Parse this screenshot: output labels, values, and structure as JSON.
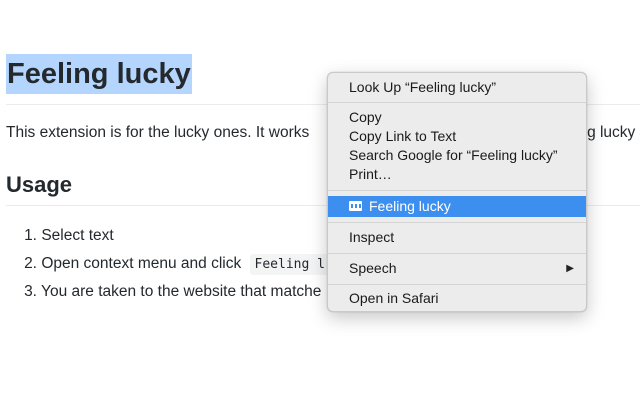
{
  "document": {
    "title": "Feeling lucky",
    "intro": "This extension is for the lucky ones. It works",
    "intro_tail": "ing lucky",
    "usage_heading": "Usage",
    "steps": [
      {
        "num": "1.",
        "text": "Select text"
      },
      {
        "num": "2.",
        "text": "Open context menu and click",
        "code": "Feeling l"
      },
      {
        "num": "3.",
        "text": "You are taken to the website that matche"
      }
    ]
  },
  "context_menu": {
    "items": {
      "look_up": "Look Up “Feeling lucky”",
      "copy": "Copy",
      "copy_link": "Copy Link to Text",
      "search_google": "Search Google for “Feeling lucky”",
      "print": "Print…",
      "feeling_lucky": "Feeling lucky",
      "inspect": "Inspect",
      "speech": "Speech",
      "open_safari": "Open in Safari"
    },
    "submenu_arrow": "▶",
    "highlight_color": "#3d8fef",
    "selection_color": "#b4d5fe"
  }
}
